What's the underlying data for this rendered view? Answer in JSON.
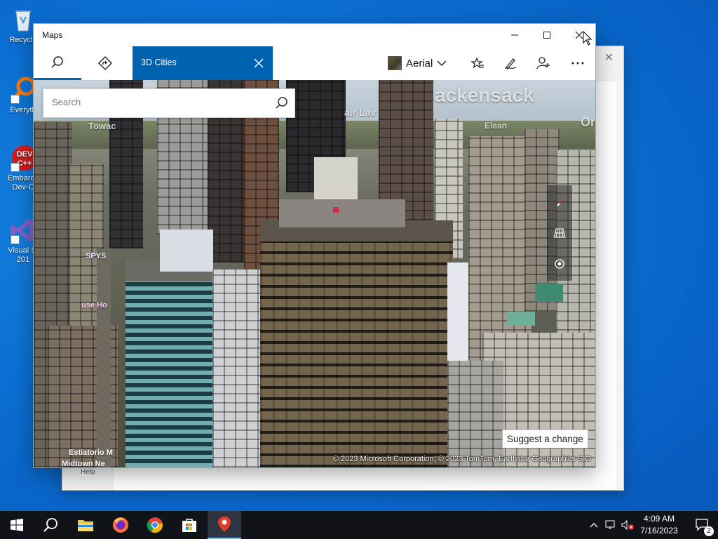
{
  "desktop": {
    "icons": [
      {
        "label": "Recycle",
        "icon": "recycle-bin-icon"
      },
      {
        "label": "Everyth",
        "icon": "everything-search-icon"
      },
      {
        "label": "Embarca",
        "label2": "Dev-C",
        "icon": "dev-cpp-icon"
      },
      {
        "label": "Visual St",
        "label2": "201",
        "icon": "visual-studio-icon"
      }
    ]
  },
  "back_window": {
    "help_label": "Help"
  },
  "maps": {
    "title": "Maps",
    "window_controls": {
      "minimize": "minimize-icon",
      "maximize": "maximize-icon",
      "close": "close-icon"
    },
    "toolbar": {
      "search_tab_icon": "search-icon",
      "directions_tab_icon": "directions-icon",
      "active_tab_label": "3D Cities",
      "map_style_label": "Aerial",
      "favorites_icon": "favorites-icon",
      "ink_icon": "pen-icon",
      "share_icon": "add-person-icon",
      "more_icon": "more-icon"
    },
    "search": {
      "placeholder": "Search"
    },
    "map_labels": {
      "city": "ackensack",
      "place1": "air Lav",
      "place2": "Towac",
      "place3": "Elean",
      "place4": "Or",
      "poi1": "SPYS",
      "poi2": "use Ho",
      "poi3": "Estiatorio M",
      "poi4": "Midtown Ne"
    },
    "map_controls": [
      "compass-icon",
      "tilt-icon",
      "locate-icon"
    ],
    "suggest_label": "Suggest a change",
    "copyright": "© 2023 Microsoft Corporation, © 2023 TomTom, Earthstar Geographics  SIO"
  },
  "taskbar": {
    "items": [
      "windows-start-icon",
      "search-icon",
      "file-explorer-icon",
      "firefox-icon",
      "chrome-icon",
      "store-icon",
      "maps-app-icon"
    ],
    "time": "4:09 AM",
    "date": "7/16/2023",
    "notification_count": "2"
  }
}
